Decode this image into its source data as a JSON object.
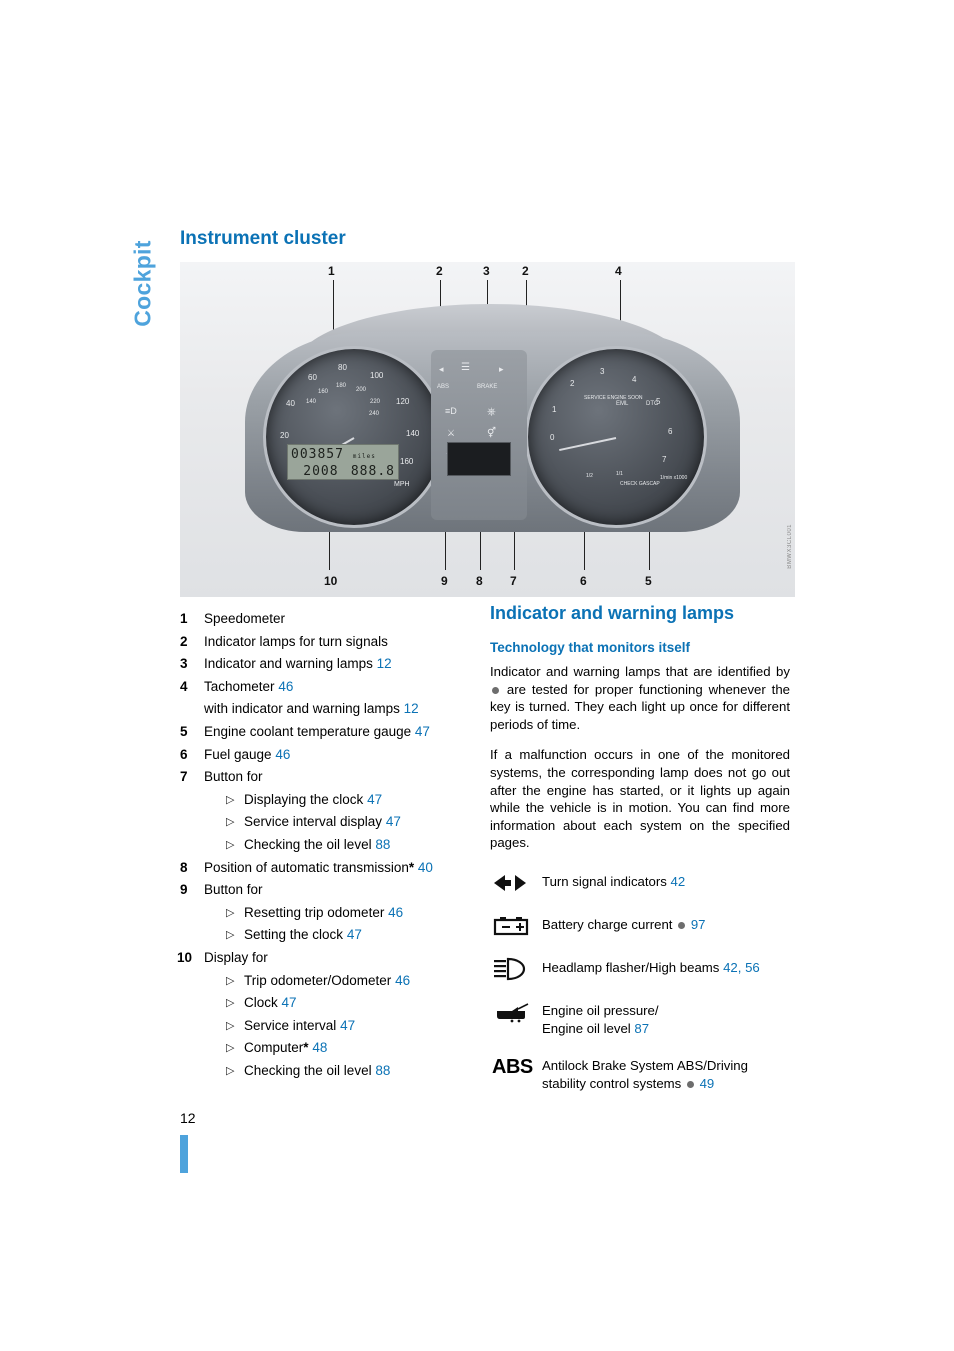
{
  "chapter": "Cockpit",
  "page_number": "12",
  "headings": {
    "instrument_cluster": "Instrument cluster",
    "indicator_warning_lamps": "Indicator and warning lamps",
    "technology": "Technology that monitors itself"
  },
  "illustration": {
    "callouts_top": [
      "1",
      "2",
      "3",
      "2",
      "4"
    ],
    "callouts_bottom": [
      "10",
      "9",
      "8",
      "7",
      "6",
      "5"
    ],
    "lcd_line1": "003857",
    "lcd_line2": "2008",
    "lcd_right": "888.8",
    "lcd_unit": "miles",
    "speed_numbers": [
      "20",
      "40",
      "60",
      "80",
      "100",
      "120",
      "140",
      "160"
    ],
    "speed_inner": [
      "20",
      "40",
      "60",
      "80",
      "100",
      "120",
      "140",
      "160",
      "180",
      "200",
      "220",
      "240"
    ],
    "speed_unit": "MPH",
    "tach_numbers": [
      "0",
      "1",
      "2",
      "3",
      "4",
      "5",
      "6",
      "7"
    ],
    "tach_unit": "1/min x1000",
    "tach_labels": [
      "SERVICE ENGINE SOON",
      "EML",
      "DTC"
    ],
    "fuel_labels": [
      "1/1",
      "1/2",
      "0",
      "CHECK GASCAP"
    ],
    "tell_labels": [
      "ABS",
      "BRAKE"
    ],
    "side_code": "BMWX3CL001"
  },
  "legend": [
    {
      "num": "1",
      "label": "Speedometer",
      "page": ""
    },
    {
      "num": "2",
      "label": "Indicator lamps for turn signals",
      "page": ""
    },
    {
      "num": "3",
      "label": "Indicator and warning lamps",
      "page": "12"
    },
    {
      "num": "4",
      "label": "Tachometer",
      "page": "46",
      "second_line": "with indicator and warning lamps",
      "second_page": "12"
    },
    {
      "num": "5",
      "label": "Engine coolant temperature gauge",
      "page": "47"
    },
    {
      "num": "6",
      "label": "Fuel gauge",
      "page": "46"
    },
    {
      "num": "7",
      "label": "Button for",
      "page": "",
      "subs": [
        {
          "label": "Displaying the clock",
          "page": "47"
        },
        {
          "label": "Service interval display",
          "page": "47"
        },
        {
          "label": "Checking the oil level",
          "page": "88"
        }
      ]
    },
    {
      "num": "8",
      "label": "Position of automatic transmission",
      "asterisk": "*",
      "page": "40"
    },
    {
      "num": "9",
      "label": "Button for",
      "page": "",
      "subs": [
        {
          "label": "Resetting trip odometer",
          "page": "46"
        },
        {
          "label": "Setting the clock",
          "page": "47"
        }
      ]
    },
    {
      "num": "10",
      "label": "Display for",
      "page": "",
      "subs": [
        {
          "label": "Trip odometer/Odometer",
          "page": "46"
        },
        {
          "label": "Clock",
          "page": "47"
        },
        {
          "label": "Service interval",
          "page": "47"
        },
        {
          "label": "Computer",
          "asterisk": "*",
          "page": "48"
        },
        {
          "label": "Checking the oil level",
          "page": "88"
        }
      ]
    }
  ],
  "body": {
    "para1_a": "Indicator and warning lamps that are identified by ",
    "para1_b": " are tested for proper functioning whenever the key is turned. They each light up once for different periods of time.",
    "para2": "If a malfunction occurs in one of the monitored systems, the corresponding lamp does not go out after the engine has started, or it lights up again while the vehicle is in motion. You can find more information about each system on the specified pages."
  },
  "lamps": [
    {
      "icon": "turn-signal-arrows-icon",
      "text": "Turn signal indicators",
      "pages": [
        "42"
      ],
      "has_dot": false
    },
    {
      "icon": "battery-icon",
      "text": "Battery charge current",
      "pages": [
        "97"
      ],
      "has_dot": true
    },
    {
      "icon": "headlamp-high-beam-icon",
      "text": "Headlamp flasher/High beams",
      "pages": [
        "42",
        "56"
      ],
      "has_dot": false
    },
    {
      "icon": "oil-can-icon",
      "text_line1": "Engine oil pressure/",
      "text_line2": "Engine oil level",
      "pages": [
        "87"
      ],
      "has_dot": false
    },
    {
      "icon": "abs-icon",
      "icon_text": "ABS",
      "text_line1": "Antilock Brake System ABS/Driving",
      "text_line2": "stability control systems",
      "pages": [
        "49"
      ],
      "has_dot": true
    }
  ],
  "colors": {
    "heading_blue": "#0b72b5",
    "tab_blue": "#4ea3dc",
    "page_ref_blue": "#0b72b5"
  }
}
